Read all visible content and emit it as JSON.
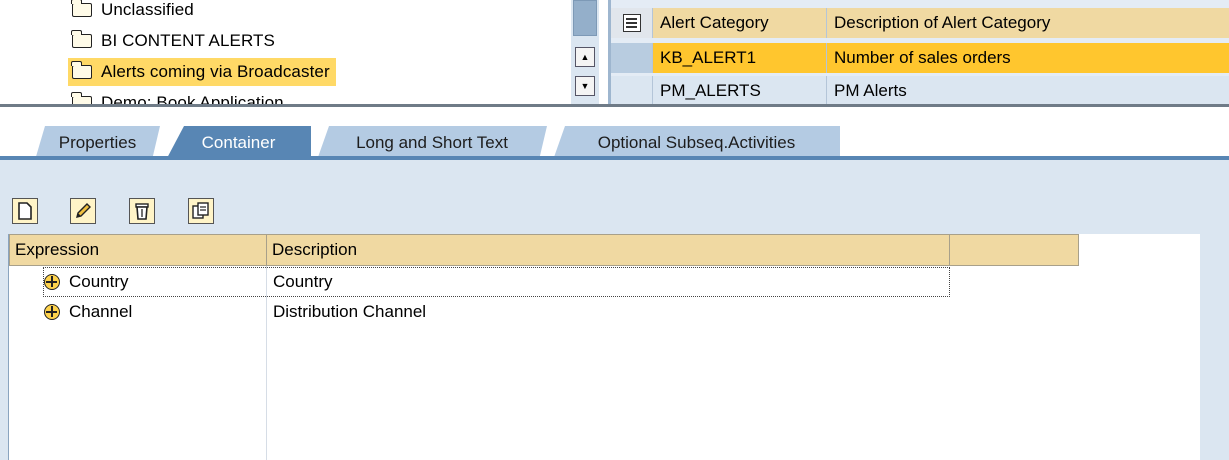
{
  "tree": {
    "items": [
      {
        "label": "Unclassified",
        "icon": "folder-icon",
        "selected": false
      },
      {
        "label": "BI CONTENT ALERTS",
        "icon": "folder-icon",
        "selected": false
      },
      {
        "label": "Alerts coming via Broadcaster",
        "icon": "folder-icon",
        "selected": true
      },
      {
        "label": "Demo: Book Application",
        "icon": "folder-icon",
        "selected": false
      }
    ]
  },
  "alert_table": {
    "headers": [
      "Alert Category",
      "Description of Alert Category"
    ],
    "rows": [
      {
        "category": "KB_ALERT1",
        "description": "Number of sales orders",
        "selected": true
      },
      {
        "category": "PM_ALERTS",
        "description": "PM Alerts",
        "selected": false
      }
    ],
    "scroll_up_glyph": "▲",
    "scroll_down_glyph": "▼"
  },
  "tabs": [
    {
      "label": "Properties",
      "active": false
    },
    {
      "label": "Container",
      "active": true
    },
    {
      "label": "Long and Short Text",
      "active": false
    },
    {
      "label": "Optional Subseq.Activities",
      "active": false
    }
  ],
  "toolbar": {
    "buttons": [
      "create-icon",
      "edit-pencil-icon",
      "delete-trash-icon",
      "copy-clipboard-icon"
    ]
  },
  "container_grid": {
    "headers": [
      "Expression",
      "Description",
      ""
    ],
    "rows": [
      {
        "expression": "Country",
        "description": "Country",
        "focused": true
      },
      {
        "expression": "Channel",
        "description": "Distribution Channel",
        "focused": false
      }
    ]
  },
  "colors": {
    "selection_yellow": "#ffc62e",
    "header_tan": "#f0d9a2",
    "active_tab_blue": "#5886b4",
    "panel_blue": "#dbe6f1"
  }
}
